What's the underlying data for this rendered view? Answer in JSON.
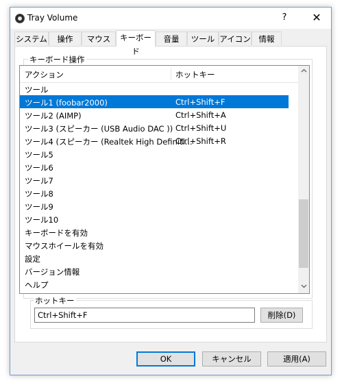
{
  "window": {
    "title": "Tray Volume",
    "help_label": "?",
    "close_label": "✕"
  },
  "tabs": [
    {
      "label": "システム"
    },
    {
      "label": "操作"
    },
    {
      "label": "マウス"
    },
    {
      "label": "キーボード",
      "active": true
    },
    {
      "label": "音量"
    },
    {
      "label": "ツール"
    },
    {
      "label": "アイコン"
    },
    {
      "label": "情報"
    }
  ],
  "keyboard_group": {
    "label": "キーボード操作"
  },
  "list": {
    "columns": [
      "アクション",
      "ホットキー"
    ],
    "rows": [
      {
        "action": "ツール",
        "hotkey": ""
      },
      {
        "action": "ツール1 (foobar2000)",
        "hotkey": "Ctrl+Shift+F",
        "selected": true
      },
      {
        "action": "ツール2 (AIMP)",
        "hotkey": "Ctrl+Shift+A"
      },
      {
        "action": "ツール3 (スピーカー (USB Audio DAC   ))",
        "hotkey": "Ctrl+Shift+U"
      },
      {
        "action": "ツール4 (スピーカー (Realtek High Definiti...",
        "hotkey": "Ctrl+Shift+R"
      },
      {
        "action": "ツール5",
        "hotkey": ""
      },
      {
        "action": "ツール6",
        "hotkey": ""
      },
      {
        "action": "ツール7",
        "hotkey": ""
      },
      {
        "action": "ツール8",
        "hotkey": ""
      },
      {
        "action": "ツール9",
        "hotkey": ""
      },
      {
        "action": "ツール10",
        "hotkey": ""
      },
      {
        "action": "キーボードを有効",
        "hotkey": ""
      },
      {
        "action": "マウスホイールを有効",
        "hotkey": ""
      },
      {
        "action": "設定",
        "hotkey": ""
      },
      {
        "action": "バージョン情報",
        "hotkey": ""
      },
      {
        "action": "ヘルプ",
        "hotkey": ""
      }
    ],
    "scroll_up_icon": "chevron-up-icon",
    "scroll_down_icon": "chevron-down-icon"
  },
  "hotkey_group": {
    "label": "ホットキー",
    "value": "Ctrl+Shift+F",
    "delete_label": "削除(D)"
  },
  "footer": {
    "ok_label": "OK",
    "cancel_label": "キャンセル",
    "apply_label": "適用(A)"
  },
  "colors": {
    "selection": "#0078d7",
    "window_bg": "#f0f0f0",
    "accent_border": "#0078d7"
  }
}
